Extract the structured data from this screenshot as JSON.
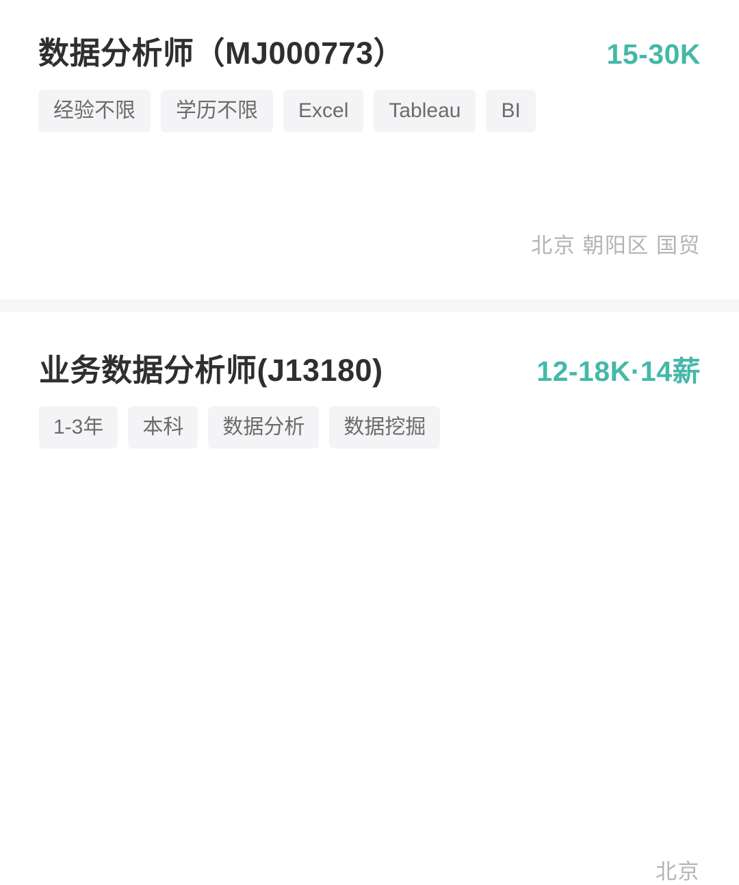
{
  "theme": {
    "background": "#ffffff",
    "salary_accent": "#45b8a8",
    "title_color": "#2f2f2f",
    "tag_background": "#f4f4f6",
    "tag_text": "#6b6b6b",
    "location_text": "#b4b4b6",
    "divider": "#f6f6f7"
  },
  "jobs": [
    {
      "title": "数据分析师（MJ000773）",
      "salary": "15-30K",
      "tags": [
        "经验不限",
        "学历不限",
        "Excel",
        "Tableau",
        "BI"
      ],
      "location": "北京 朝阳区 国贸"
    },
    {
      "title": "业务数据分析师(J13180)",
      "salary": "12-18K·14薪",
      "tags": [
        "1-3年",
        "本科",
        "数据分析",
        "数据挖掘"
      ],
      "location": "北京"
    }
  ]
}
